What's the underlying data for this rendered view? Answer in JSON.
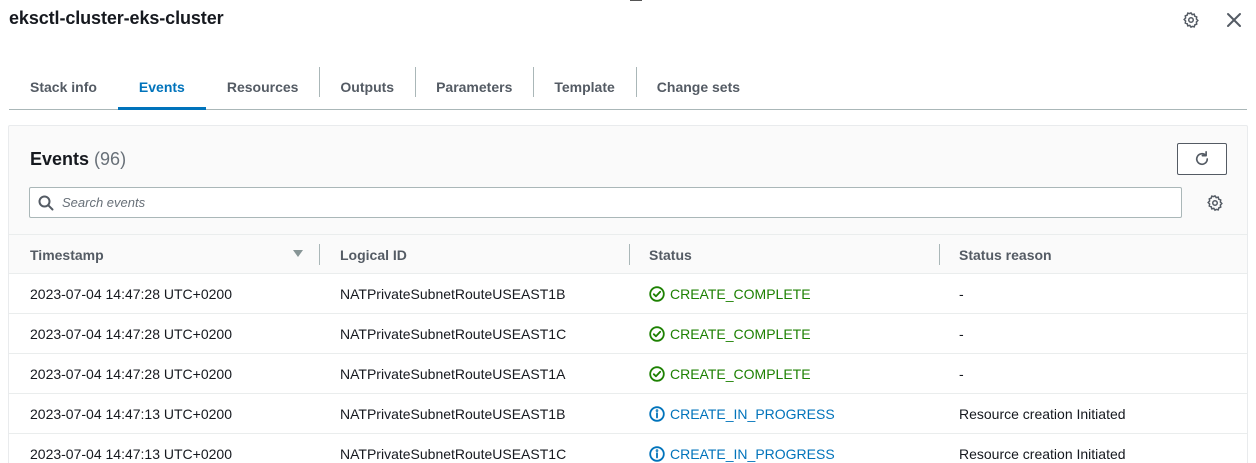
{
  "header": {
    "title": "eksctl-cluster-eks-cluster",
    "icons": [
      "gear-icon",
      "close-icon"
    ]
  },
  "tabs": [
    {
      "label": "Stack info",
      "active": false
    },
    {
      "label": "Events",
      "active": true
    },
    {
      "label": "Resources",
      "active": false
    },
    {
      "label": "Outputs",
      "active": false
    },
    {
      "label": "Parameters",
      "active": false
    },
    {
      "label": "Template",
      "active": false
    },
    {
      "label": "Change sets",
      "active": false
    }
  ],
  "events": {
    "title": "Events",
    "count": "(96)",
    "search_placeholder": "Search events",
    "search_value": "",
    "columns": [
      "Timestamp",
      "Logical ID",
      "Status",
      "Status reason"
    ],
    "sort": {
      "column": "Timestamp",
      "direction": "descending"
    },
    "rows": [
      {
        "timestamp": "2023-07-04 14:47:28 UTC+0200",
        "logical_id": "NATPrivateSubnetRouteUSEAST1B",
        "status": "CREATE_COMPLETE",
        "status_type": "complete",
        "reason": "-"
      },
      {
        "timestamp": "2023-07-04 14:47:28 UTC+0200",
        "logical_id": "NATPrivateSubnetRouteUSEAST1C",
        "status": "CREATE_COMPLETE",
        "status_type": "complete",
        "reason": "-"
      },
      {
        "timestamp": "2023-07-04 14:47:28 UTC+0200",
        "logical_id": "NATPrivateSubnetRouteUSEAST1A",
        "status": "CREATE_COMPLETE",
        "status_type": "complete",
        "reason": "-"
      },
      {
        "timestamp": "2023-07-04 14:47:13 UTC+0200",
        "logical_id": "NATPrivateSubnetRouteUSEAST1B",
        "status": "CREATE_IN_PROGRESS",
        "status_type": "progress",
        "reason": "Resource creation Initiated"
      },
      {
        "timestamp": "2023-07-04 14:47:13 UTC+0200",
        "logical_id": "NATPrivateSubnetRouteUSEAST1C",
        "status": "CREATE_IN_PROGRESS",
        "status_type": "progress",
        "reason": "Resource creation Initiated"
      }
    ]
  },
  "colors": {
    "accent": "#0073bb",
    "success": "#1d8102",
    "text": "#16191f",
    "muted": "#545b64"
  }
}
